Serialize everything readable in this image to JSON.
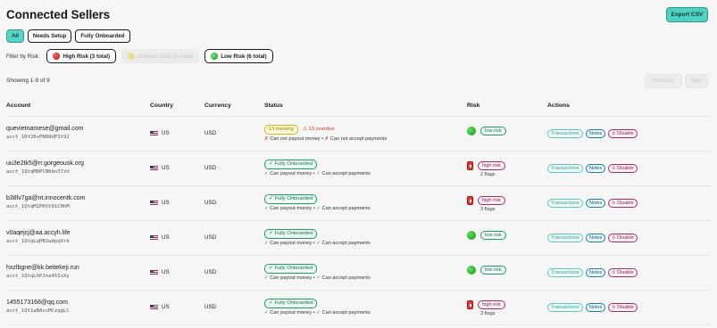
{
  "header": {
    "title": "Connected Sellers",
    "export_label": "Export CSV"
  },
  "tabs": [
    {
      "label": "All",
      "active": true
    },
    {
      "label": "Needs Setup",
      "active": false
    },
    {
      "label": "Fully Onboarded",
      "active": false
    }
  ],
  "risk_filter": {
    "label": "Filter by Risk:",
    "chips": [
      {
        "label": "High Risk (3 total)",
        "dot": "red",
        "disabled": false
      },
      {
        "label": "Medium Risk (0 total)",
        "dot": "yellow",
        "disabled": true
      },
      {
        "label": "Low Risk (6 total)",
        "dot": "green",
        "disabled": false
      }
    ]
  },
  "pagination": {
    "showing": "Showing 1-9 of 9",
    "prev_label": "Previous",
    "next_label": "Next"
  },
  "columns": {
    "account": "Account",
    "country": "Country",
    "currency": "Currency",
    "status": "Status",
    "risk": "Risk",
    "actions": "Actions"
  },
  "action_labels": {
    "transactions": "Transactions",
    "notes": "Notes",
    "disable": "Disable"
  },
  "rows": [
    {
      "email": "quevietnamese@gmail.com",
      "acct": "acct_1Rf26vPN08UP3t92",
      "country": "US",
      "currency": "USD",
      "status_pill": "13 missing",
      "status_type": "missing",
      "overdue": "13 overdue",
      "status_line": [
        {
          "mark": "✗",
          "text": "Can not payout money"
        },
        {
          "mark": "✗",
          "text": "Can not accept payments"
        }
      ],
      "risk_label": "low risk",
      "risk_level": "low",
      "flags": ""
    },
    {
      "email": "uu3e2tk5@rr.gorgeousk.org",
      "acct": "acct_1QtqMDPCN6bn37zU",
      "country": "US",
      "currency": "USD",
      "status_pill": "✓ Fully Onboarded",
      "status_type": "onboarded",
      "overdue": "",
      "status_line": [
        {
          "mark": "✓",
          "text": "Can payout money"
        },
        {
          "mark": "✓",
          "text": "Can accept payments"
        }
      ],
      "risk_label": "high risk",
      "risk_level": "high",
      "flags": "2 flags"
    },
    {
      "email": "b38lv7ga@nt.innocentk.com",
      "acct": "acct_1QtqM1PKVt01C0hM",
      "country": "US",
      "currency": "USD",
      "status_pill": "✓ Fully Onboarded",
      "status_type": "onboarded",
      "overdue": "",
      "status_line": [
        {
          "mark": "✓",
          "text": "Can payout money"
        },
        {
          "mark": "✓",
          "text": "Can accept payments"
        }
      ],
      "risk_label": "high risk",
      "risk_level": "high",
      "flags": "3 flags"
    },
    {
      "email": "v0aqejcj@aa.accyh.life",
      "acct": "acct_1QtqLqPB2wdpqOrk",
      "country": "US",
      "currency": "USD",
      "status_pill": "✓ Fully Onboarded",
      "status_type": "onboarded",
      "overdue": "",
      "status_line": [
        {
          "mark": "✓",
          "text": "Can payout money"
        },
        {
          "mark": "✓",
          "text": "Can accept payments"
        }
      ],
      "risk_label": "low risk",
      "risk_level": "low",
      "flags": ""
    },
    {
      "email": "hxzlbgne@kk.beitekeji.run",
      "acct": "acct_1QtqLhPJna45IoXy",
      "country": "US",
      "currency": "USD",
      "status_pill": "✓ Fully Onboarded",
      "status_type": "onboarded",
      "overdue": "",
      "status_line": [
        {
          "mark": "✓",
          "text": "Can payout money"
        },
        {
          "mark": "✓",
          "text": "Can accept payments"
        }
      ],
      "risk_label": "low risk",
      "risk_level": "low",
      "flags": ""
    },
    {
      "email": "1455173168@qq.com",
      "acct": "acct_1Qt1aBAccMCzqgLl",
      "country": "US",
      "currency": "USD",
      "status_pill": "✓ Fully Onboarded",
      "status_type": "onboarded",
      "overdue": "",
      "status_line": [
        {
          "mark": "✓",
          "text": "Can payout money"
        },
        {
          "mark": "✓",
          "text": "Can accept payments"
        }
      ],
      "risk_label": "high risk",
      "risk_level": "high",
      "flags": "3 flags"
    }
  ]
}
